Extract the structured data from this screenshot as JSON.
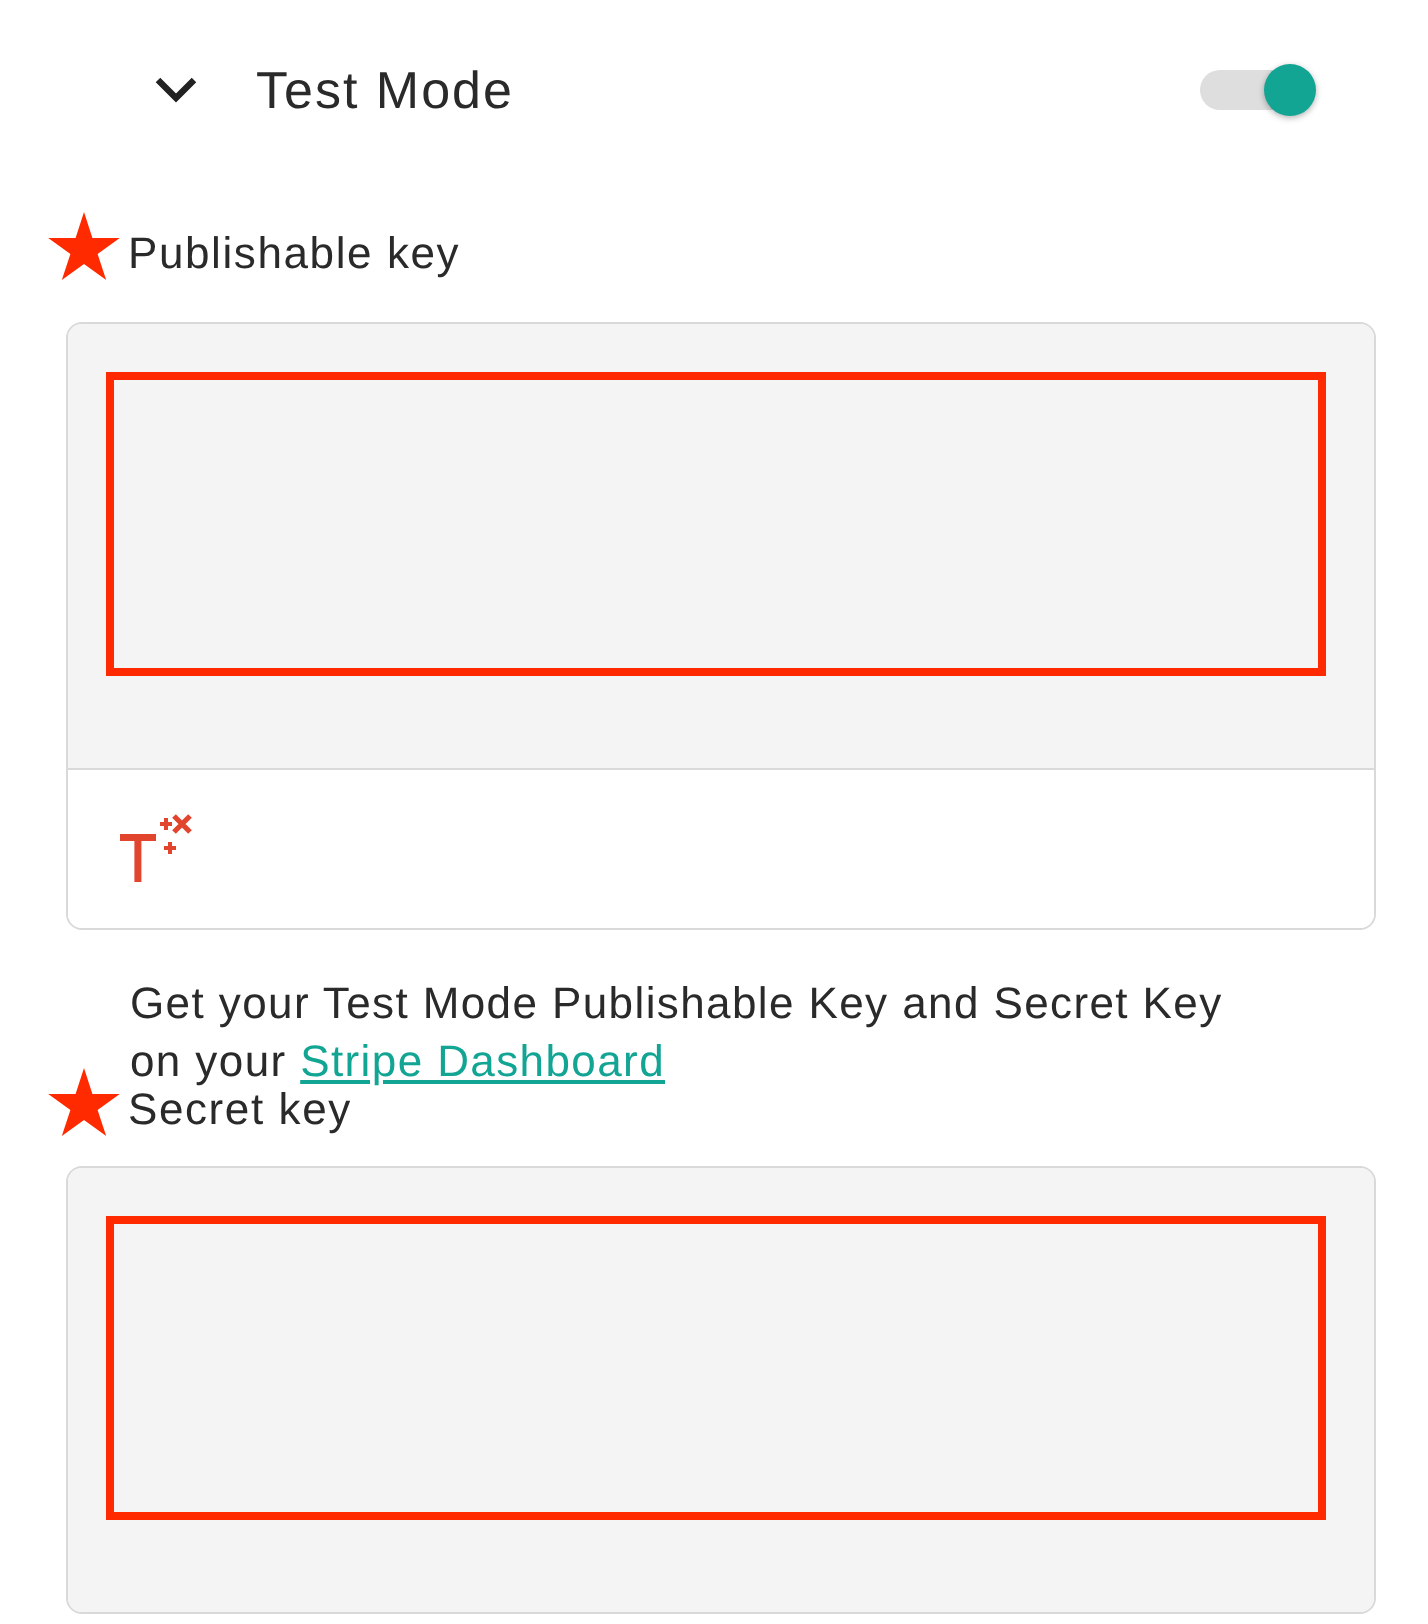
{
  "header": {
    "title": "Test Mode",
    "expanded": true,
    "toggle": {
      "on": true
    }
  },
  "fields": [
    {
      "label": "Publishable key",
      "starred": true,
      "redacted": true,
      "toolbar": true,
      "help": {
        "text": "Get your Test Mode Publishable Key and Secret Key on your ",
        "link": "Stripe Dashboard"
      }
    },
    {
      "label": "Secret key",
      "starred": true,
      "redacted": true,
      "toolbar": false
    }
  ]
}
